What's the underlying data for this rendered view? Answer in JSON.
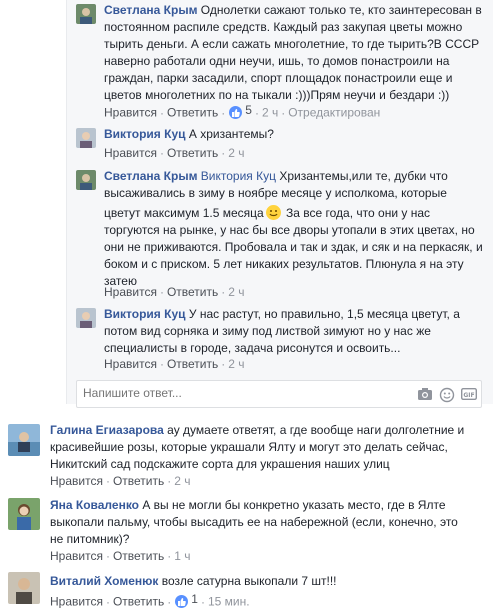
{
  "actions": {
    "like": "Нравится",
    "reply": "Ответить",
    "edited": "Отредактирован"
  },
  "replies": [
    {
      "author": "Светлана Крым",
      "lines": [
        "Однолетки сажают только те, кто заинтересован в",
        "постоянном распиле средств. Каждый раз закупая цветы можно",
        "тырить деньги. А если сажать многолетние, то где тырить?В СССР",
        "наверно работали одни неучи, ишь, то домов понастроили на",
        "граждан, парки засадили, спорт площадок понастроили еще и",
        "цветов многолетних по на тыкали :)))Прям неучи и бездари :))"
      ],
      "likes": "5",
      "time": "2 ч"
    },
    {
      "author": "Виктория Куц",
      "lines": [
        "А хризантемы?"
      ],
      "time": "2 ч"
    },
    {
      "author": "Светлана Крым",
      "mention": "Виктория Куц",
      "lines": [
        "Хризантемы,или те, дубки что",
        "высаживались в зиму в ноябре месяце у исполкома, которые",
        "цветут максимум 1.5 месяца",
        "За все года, что они у нас",
        "торгуются на рынке, у нас бы все дворы утопали в этих цветах, но",
        "они не приживаются. Пробовала и так и здак, и сяк и на перкасяк, и",
        "боком и с приском. 5 лет никаких результатов. Плюнула я на эту",
        "затею"
      ],
      "time": "2 ч"
    },
    {
      "author": "Виктория Куц",
      "lines": [
        "У нас растут, но правильно, 1,5 месяца цветут, а",
        "потом вид сорняка и зиму под листвой зимуют но у нас же",
        "специалисты в городе, задача рисонутся и освоить..."
      ],
      "time": "2 ч"
    }
  ],
  "reply_box": {
    "placeholder": "Напишите ответ..."
  },
  "comments": [
    {
      "author": "Галина Егиазарова",
      "lines": [
        "ау думаете ответят, а где вообще наги долголетние и",
        "красивейшие розы, которые украшали Ялту и могут это делать сейчас,",
        "Никитский сад подскажите сорта для украшения наших улиц"
      ],
      "time": "2 ч"
    },
    {
      "author": "Яна Коваленко",
      "lines": [
        "А вы не могли бы конкретно указать место, где в Ялте",
        "выкопали пальму, чтобы высадить ее на набережной (если, конечно, это",
        "не питомник)?"
      ],
      "time": "1 ч"
    },
    {
      "author": "Виталий Хоменюк",
      "lines": [
        "возле сатурна выкопали 7 шт!!!"
      ],
      "likes": "1",
      "time": "15 мин."
    }
  ],
  "colors": {
    "link": "#365899",
    "meta": "#90949c",
    "like_badge": "#5890ff",
    "rail": "#f6f7f9"
  }
}
